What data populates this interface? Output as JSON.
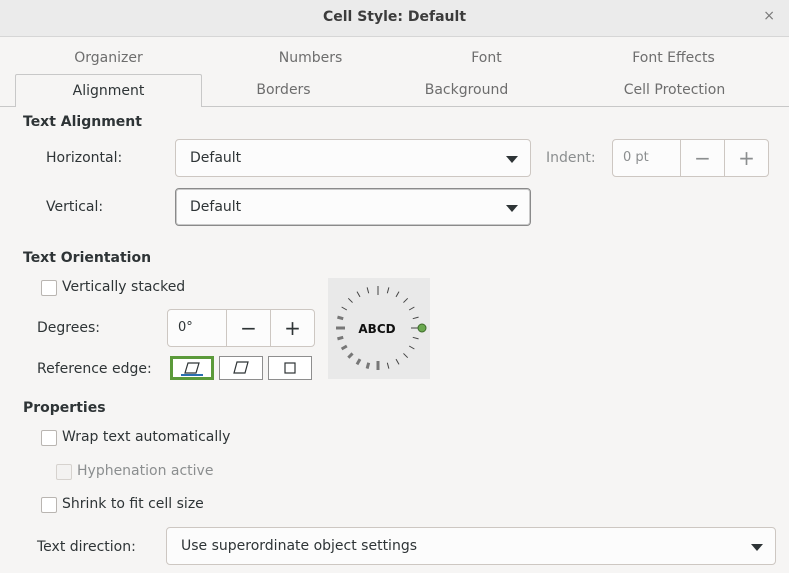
{
  "window": {
    "title": "Cell Style: Default",
    "close_glyph": "×"
  },
  "tabs_row1": [
    "Organizer",
    "Numbers",
    "Font",
    "Font Effects"
  ],
  "tabs_row2": [
    "Alignment",
    "Borders",
    "Background",
    "Cell Protection"
  ],
  "active_tab": "Alignment",
  "text_alignment": {
    "heading": "Text Alignment",
    "horizontal_label": "Horizontal:",
    "horizontal_value": "Default",
    "vertical_label": "Vertical:",
    "vertical_value": "Default",
    "indent_label": "Indent:",
    "indent_value": "0 pt"
  },
  "text_orientation": {
    "heading": "Text Orientation",
    "vertically_stacked_label": "Vertically stacked",
    "vertically_stacked_checked": false,
    "degrees_label": "Degrees:",
    "degrees_value": "0°",
    "reference_edge_label": "Reference edge:",
    "reference_edge_selected": 0,
    "dial_text": "ABCD"
  },
  "properties": {
    "heading": "Properties",
    "wrap_label": "Wrap text automatically",
    "hyphenation_label": "Hyphenation active",
    "shrink_label": "Shrink to fit cell size",
    "text_direction_label": "Text direction:",
    "text_direction_value": "Use superordinate object settings"
  },
  "spin_minus": "−",
  "spin_plus": "+",
  "colors": {
    "selected_edge_border": "#5b9a3a",
    "dial_dot": "#6aa84f"
  }
}
